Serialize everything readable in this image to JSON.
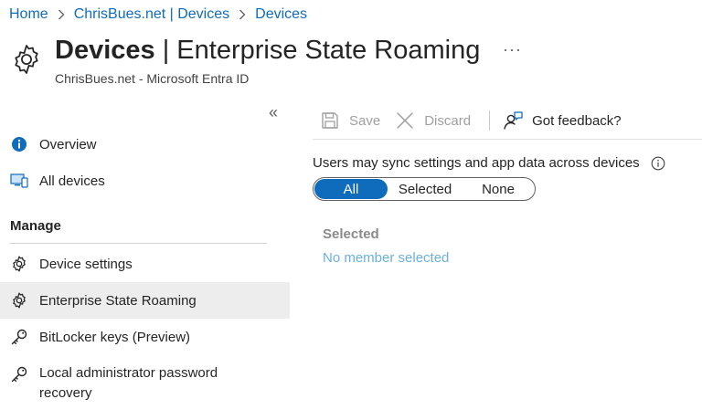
{
  "breadcrumb": {
    "items": [
      "Home",
      "ChrisBues.net | Devices",
      "Devices"
    ]
  },
  "header": {
    "title_bold": "Devices",
    "title_rest": " | Enterprise State Roaming",
    "subtitle": "ChrisBues.net - Microsoft Entra ID",
    "more": "···"
  },
  "sidebar": {
    "collapse": "«",
    "items": [
      {
        "label": "Overview",
        "icon": "info-icon"
      },
      {
        "label": "All devices",
        "icon": "devices-icon"
      }
    ],
    "section_title": "Manage",
    "manage_items": [
      {
        "label": "Device settings",
        "icon": "gear-icon"
      },
      {
        "label": "Enterprise State Roaming",
        "icon": "gear-icon",
        "active": true
      },
      {
        "label": "BitLocker keys (Preview)",
        "icon": "key-icon"
      },
      {
        "label": "Local administrator password recovery",
        "icon": "key-icon"
      }
    ]
  },
  "toolbar": {
    "save_label": "Save",
    "discard_label": "Discard",
    "feedback_label": "Got feedback?"
  },
  "content": {
    "setting_label": "Users may sync settings and app data across devices",
    "toggle": {
      "options": [
        "All",
        "Selected",
        "None"
      ],
      "selected": "All"
    },
    "selected_title": "Selected",
    "selected_empty": "No member selected"
  },
  "colors": {
    "accent": "#0f6cbd",
    "link_light": "#6cb0e0",
    "active_bg": "#ededed"
  }
}
